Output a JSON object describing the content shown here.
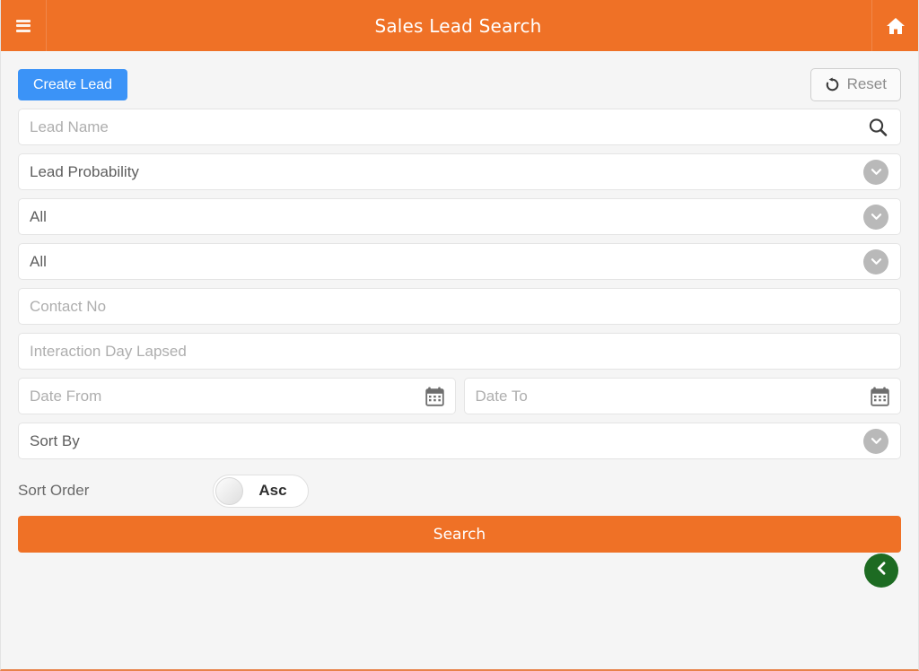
{
  "header": {
    "menu_icon": "hamburger-menu-icon",
    "title": "Sales Lead Search",
    "home_icon": "home-icon",
    "background_color": "#ef7126"
  },
  "toolbar": {
    "create_label": "Create Lead",
    "create_color": "#3b93f7",
    "reset_label": "Reset",
    "reset_icon": "refresh-icon"
  },
  "form": {
    "lead_name": {
      "placeholder": "Lead Name",
      "value": "",
      "icon": "search-icon"
    },
    "lead_probability": {
      "value": "Lead Probability",
      "icon": "chevron-down-icon"
    },
    "lead_status": {
      "value": "All",
      "icon": "chevron-down-icon"
    },
    "lead_source": {
      "value": "All",
      "icon": "chevron-down-icon"
    },
    "contact_no": {
      "placeholder": "Contact No",
      "value": ""
    },
    "interaction_day_lapsed": {
      "placeholder": "Interaction Day Lapsed",
      "value": ""
    },
    "date_from": {
      "placeholder": "Date From",
      "value": "",
      "icon": "calendar-icon"
    },
    "date_to": {
      "placeholder": "Date To",
      "value": "",
      "icon": "calendar-icon"
    },
    "sort_by": {
      "value": "Sort By",
      "icon": "chevron-down-icon"
    },
    "sort_order": {
      "label": "Sort Order",
      "toggle_value": "Asc"
    }
  },
  "actions": {
    "search_label": "Search",
    "search_color": "#ef7126",
    "back_icon": "chevron-left-icon",
    "back_color": "#1d6b22"
  }
}
